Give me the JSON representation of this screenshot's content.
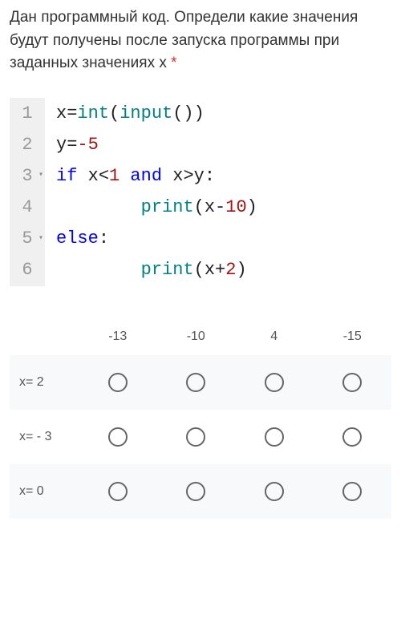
{
  "question": {
    "text": "Дан программный код. Определи какие значения будут получены после запуска программы при заданных значениях х",
    "required_mark": "*"
  },
  "code": {
    "lines": [
      {
        "n": "1",
        "chev": false,
        "content": [
          {
            "t": "var",
            "s": "x"
          },
          {
            "t": "op",
            "s": "="
          },
          {
            "t": "fn",
            "s": "int"
          },
          {
            "t": "op",
            "s": "("
          },
          {
            "t": "fn",
            "s": "input"
          },
          {
            "t": "op",
            "s": "())"
          }
        ]
      },
      {
        "n": "2",
        "chev": false,
        "content": [
          {
            "t": "var",
            "s": "y"
          },
          {
            "t": "op",
            "s": "="
          },
          {
            "t": "num",
            "s": "-5"
          }
        ]
      },
      {
        "n": "3",
        "chev": true,
        "content": [
          {
            "t": "kw",
            "s": "if"
          },
          {
            "t": "op",
            "s": " "
          },
          {
            "t": "var",
            "s": "x"
          },
          {
            "t": "op",
            "s": "<"
          },
          {
            "t": "num",
            "s": "1"
          },
          {
            "t": "op",
            "s": " "
          },
          {
            "t": "kw",
            "s": "and"
          },
          {
            "t": "op",
            "s": " "
          },
          {
            "t": "var",
            "s": "x"
          },
          {
            "t": "op",
            "s": ">"
          },
          {
            "t": "var",
            "s": "y"
          },
          {
            "t": "op",
            "s": ":"
          }
        ]
      },
      {
        "n": "4",
        "chev": false,
        "indent": "        ",
        "content": [
          {
            "t": "fn",
            "s": "print"
          },
          {
            "t": "op",
            "s": "("
          },
          {
            "t": "var",
            "s": "x"
          },
          {
            "t": "op",
            "s": "-"
          },
          {
            "t": "num",
            "s": "10"
          },
          {
            "t": "op",
            "s": ")"
          }
        ]
      },
      {
        "n": "5",
        "chev": true,
        "content": [
          {
            "t": "kw",
            "s": "else"
          },
          {
            "t": "op",
            "s": ":"
          }
        ]
      },
      {
        "n": "6",
        "chev": false,
        "indent": "        ",
        "content": [
          {
            "t": "fn",
            "s": "print"
          },
          {
            "t": "op",
            "s": "("
          },
          {
            "t": "var",
            "s": "x"
          },
          {
            "t": "op",
            "s": "+"
          },
          {
            "t": "num",
            "s": "2"
          },
          {
            "t": "op",
            "s": ")"
          }
        ]
      }
    ]
  },
  "grid": {
    "columns": [
      "-13",
      "-10",
      "4",
      "-15"
    ],
    "rows": [
      {
        "label": "x= 2",
        "shaded": true
      },
      {
        "label": "x= - 3",
        "shaded": false
      },
      {
        "label": "x= 0",
        "shaded": true
      }
    ]
  }
}
